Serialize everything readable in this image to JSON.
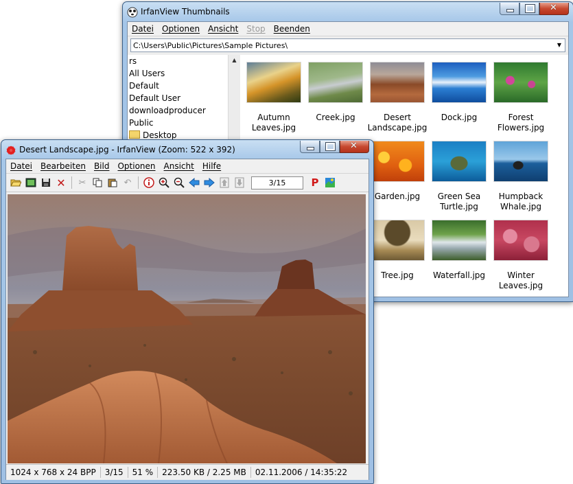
{
  "thumb_window": {
    "title": "IrfanView Thumbnails",
    "menu": [
      {
        "label": "Datei",
        "disabled": false
      },
      {
        "label": "Optionen",
        "disabled": false
      },
      {
        "label": "Ansicht",
        "disabled": false
      },
      {
        "label": "Stop",
        "disabled": true
      },
      {
        "label": "Beenden",
        "disabled": false
      }
    ],
    "path": "C:\\Users\\Public\\Pictures\\Sample Pictures\\",
    "tree": [
      "rs",
      "All Users",
      "Default",
      "Default User",
      "downloadproducer",
      "Public",
      "Desktop"
    ],
    "thumbnails": [
      {
        "name": "Autumn Leaves.jpg",
        "line1": "Autumn",
        "line2": "Leaves.jpg"
      },
      {
        "name": "Creek.jpg",
        "line1": "Creek.jpg",
        "line2": ""
      },
      {
        "name": "Desert Landscape.jpg",
        "line1": "Desert",
        "line2": "Landscape.jpg"
      },
      {
        "name": "Dock.jpg",
        "line1": "Dock.jpg",
        "line2": ""
      },
      {
        "name": "Forest Flowers.jpg",
        "line1": "Forest",
        "line2": "Flowers.jpg"
      },
      {
        "name": "Garden.jpg",
        "line1": "Garden.jpg",
        "line2": ""
      },
      {
        "name": "Green Sea Turtle.jpg",
        "line1": "Green Sea",
        "line2": "Turtle.jpg"
      },
      {
        "name": "Humpback Whale.jpg",
        "line1": "Humpback",
        "line2": "Whale.jpg"
      },
      {
        "name": "Tree.jpg",
        "line1": "Tree.jpg",
        "line2": "",
        "selected": true
      },
      {
        "name": "Waterfall.jpg",
        "line1": "Waterfall.jpg",
        "line2": ""
      },
      {
        "name": "Winter Leaves.jpg",
        "line1": "Winter",
        "line2": "Leaves.jpg"
      }
    ]
  },
  "viewer_window": {
    "title": "Desert Landscape.jpg - IrfanView (Zoom: 522 x 392)",
    "menu": [
      "Datei",
      "Bearbeiten",
      "Bild",
      "Optionen",
      "Ansicht",
      "Hilfe"
    ],
    "toolbar": {
      "page_indicator": "3/15",
      "icons": [
        "open-folder-icon",
        "slideshow-icon",
        "save-icon",
        "delete-icon",
        "cut-icon",
        "copy-icon",
        "paste-icon",
        "undo-icon",
        "info-icon",
        "zoom-in-icon",
        "zoom-out-icon",
        "previous-icon",
        "next-icon",
        "first-page-icon",
        "last-page-icon",
        "print-icon",
        "irfanview-icon"
      ]
    },
    "status": {
      "dimensions": "1024 x 768 x 24 BPP",
      "position": "3/15",
      "zoom": "51 %",
      "size": "223.50 KB / 2.25 MB",
      "datetime": "02.11.2006 / 14:35:22"
    }
  },
  "colors": {
    "title_bar": "#a9c7e8",
    "close_button": "#c7492f",
    "window_border": "#3a5e86"
  }
}
